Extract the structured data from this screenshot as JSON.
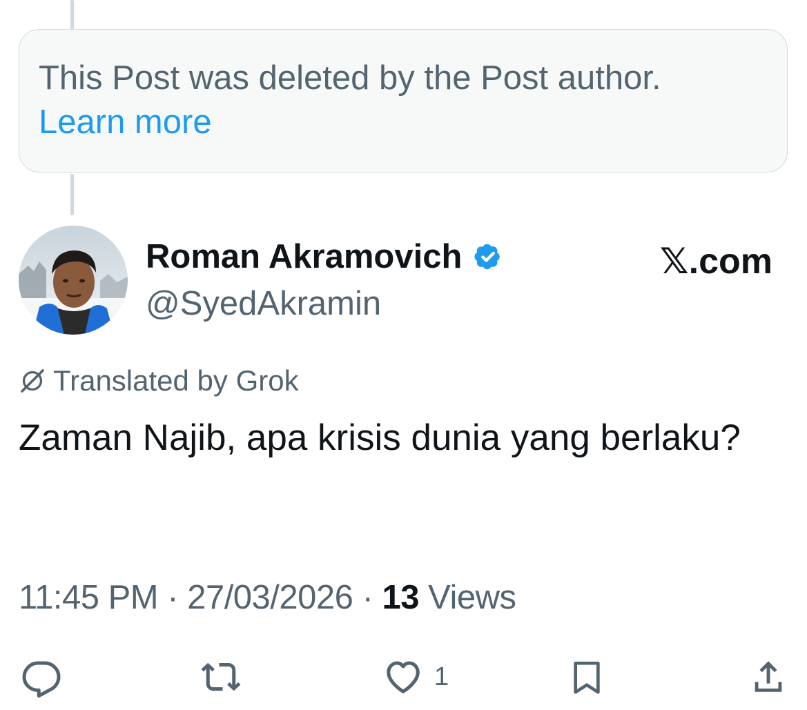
{
  "deleted_notice": {
    "text": "This Post was deleted by the Post author.",
    "link_label": "Learn more"
  },
  "author": {
    "display_name": "Roman Akramovich",
    "handle": "@SyedAkramin",
    "verified": true,
    "verified_color": "#1d9bf0",
    "avatar_icon": "profile-photo"
  },
  "site_logo": "𝕏.com",
  "translation": {
    "icon": "grok-icon",
    "label": "Translated by Grok"
  },
  "post": {
    "text": "Zaman Najib, apa krisis dunia yang berlaku?"
  },
  "meta": {
    "time": "11:45 PM",
    "separator": "·",
    "date": "27/03/2026",
    "views_count": "13",
    "views_label": "Views"
  },
  "actions": {
    "reply_icon": "reply-icon",
    "repost_icon": "repost-icon",
    "like_icon": "heart-icon",
    "like_count": "1",
    "bookmark_icon": "bookmark-icon",
    "share_icon": "share-icon"
  },
  "colors": {
    "primary_text": "#0f1419",
    "secondary_text": "#536471",
    "link": "#1d9bf0",
    "border": "#cfd9de",
    "card_background": "#f7f9f9"
  }
}
